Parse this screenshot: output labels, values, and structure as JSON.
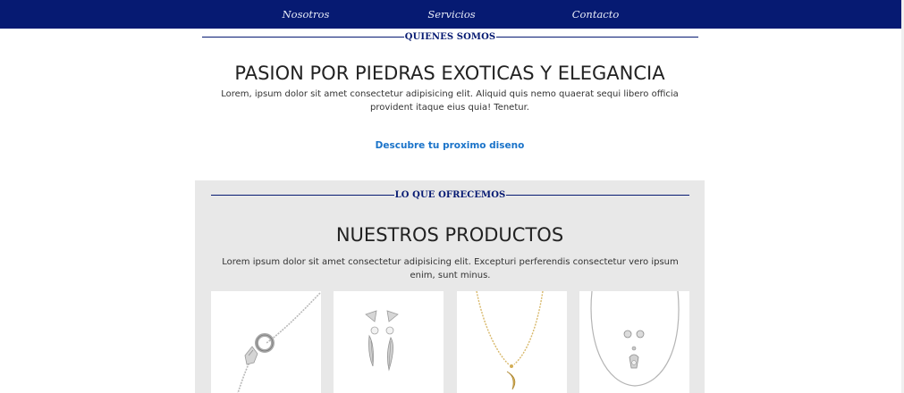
{
  "nav": {
    "items": [
      {
        "label": "Nosotros"
      },
      {
        "label": "Servicios"
      },
      {
        "label": "Contacto"
      }
    ]
  },
  "about": {
    "section_label": "QUIENES SOMOS",
    "title": "PASION POR PIEDRAS EXOTICAS Y ELEGANCIA",
    "text_line1": "Lorem, ipsum dolor sit amet consectetur adipisicing elit. Aliquid quis nemo quaerat sequi libero officia",
    "text_line2": "provident itaque eius quia! Tenetur.",
    "cta_label": "Descubre tu proximo diseno"
  },
  "products": {
    "section_label": "LO QUE OFRECEMOS",
    "title": "NUESTROS PRODUCTOS",
    "text_line1": "Lorem ipsum dolor sit amet consectetur adipisicing elit. Excepturi perferendis consectetur vero ipsum",
    "text_line2": "enim, sunt minus.",
    "items": [
      {
        "image": "silver-bracelet-with-ring-charm"
      },
      {
        "image": "silver-leaf-pearl-earrings"
      },
      {
        "image": "gold-moon-pendant-necklace"
      },
      {
        "image": "silver-necklace-and-stud-earrings-set"
      }
    ]
  },
  "colors": {
    "navbar": "#061a72",
    "accent_link": "#1a73c9",
    "section_bg": "#e8e8e8"
  }
}
